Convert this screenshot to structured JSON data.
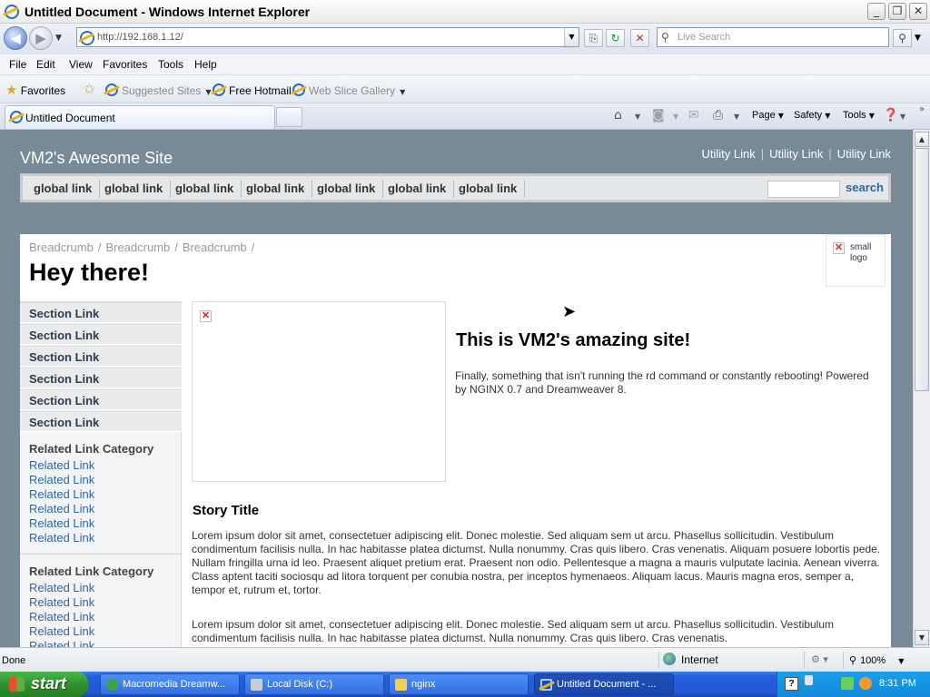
{
  "window": {
    "title": "Untitled Document - Windows Internet Explorer",
    "minimize_glyph": "_",
    "maximize_glyph": "❐",
    "close_glyph": "✕"
  },
  "address": {
    "url": "http://192.168.1.12/",
    "search_placeholder": "Live Search"
  },
  "menu": [
    "File",
    "Edit",
    "View",
    "Favorites",
    "Tools",
    "Help"
  ],
  "favorites_bar": {
    "favorites_label": "Favorites",
    "items": [
      {
        "label": "Suggested Sites",
        "muted": true,
        "dropdown": true
      },
      {
        "label": "Free Hotmail",
        "muted": false,
        "dropdown": false
      },
      {
        "label": "Web Slice Gallery",
        "muted": true,
        "dropdown": true
      }
    ]
  },
  "tabs": {
    "active_label": "Untitled Document"
  },
  "command_bar": {
    "page_label": "Page",
    "safety_label": "Safety",
    "tools_label": "Tools"
  },
  "site": {
    "name": "VM2's Awesome Site",
    "utility_links": [
      "Utility Link",
      "Utility Link",
      "Utility Link"
    ],
    "global_links": [
      "global link",
      "global link",
      "global link",
      "global link",
      "global link",
      "global link",
      "global link"
    ],
    "search_button": "search",
    "breadcrumbs": [
      "Breadcrumb",
      "Breadcrumb",
      "Breadcrumb"
    ],
    "breadcrumb_separator": "/",
    "page_title": "Hey there!",
    "logo_alt": "small logo",
    "section_links": [
      "Section Link",
      "Section Link",
      "Section Link",
      "Section Link",
      "Section Link",
      "Section Link"
    ],
    "related": [
      {
        "category": "Related Link Category",
        "links": [
          "Related Link",
          "Related Link",
          "Related Link",
          "Related Link",
          "Related Link",
          "Related Link"
        ]
      },
      {
        "category": "Related Link Category",
        "links": [
          "Related Link",
          "Related Link",
          "Related Link",
          "Related Link",
          "Related Link"
        ]
      }
    ],
    "hero_heading": "This is VM2's amazing site!",
    "hero_text": "Finally, something that isn't running the rd command or constantly rebooting! Powered by NGINX 0.7 and Dreamweaver 8.",
    "story_title": "Story Title",
    "paragraphs": [
      "Lorem ipsum dolor sit amet, consectetuer adipiscing elit. Donec molestie. Sed aliquam sem ut arcu. Phasellus sollicitudin. Vestibulum condimentum facilisis nulla. In hac habitasse platea dictumst. Nulla nonummy. Cras quis libero. Cras venenatis. Aliquam posuere lobortis pede. Nullam fringilla urna id leo. Praesent aliquet pretium erat. Praesent non odio. Pellentesque a magna a mauris vulputate lacinia. Aenean viverra. Class aptent taciti sociosqu ad litora torquent per conubia nostra, per inceptos hymenaeos. Aliquam lacus. Mauris magna eros, semper a, tempor et, rutrum et, tortor.",
      "Lorem ipsum dolor sit amet, consectetuer adipiscing elit. Donec molestie. Sed aliquam sem ut arcu. Phasellus sollicitudin. Vestibulum condimentum facilisis nulla. In hac habitasse platea dictumst. Nulla nonummy. Cras quis libero. Cras venenatis."
    ]
  },
  "status": {
    "text": "Done",
    "zone": "Internet",
    "zoom": "100%"
  },
  "taskbar": {
    "start_label": "start",
    "tasks": [
      {
        "label": "Macromedia Dreamw...",
        "active": false
      },
      {
        "label": "Local Disk (C:)",
        "active": false
      },
      {
        "label": "nginx",
        "active": false
      },
      {
        "label": "Untitled Document - ...",
        "active": true
      }
    ],
    "clock": "8:31 PM"
  },
  "colors": {
    "page_background": "#768a98",
    "link_blue": "#2e67a8",
    "taskbar_blue": "#245edb",
    "start_green": "#2f922f"
  }
}
